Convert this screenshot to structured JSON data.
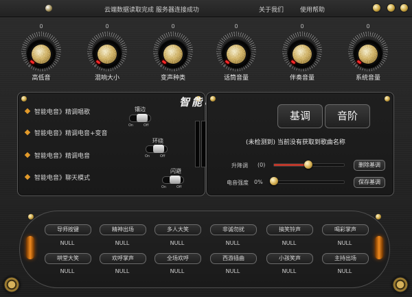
{
  "topbar": {
    "status": "云端数据读取完成 服务器连接成功",
    "about": "关于我们",
    "help": "使用帮助"
  },
  "knobs": [
    {
      "label": "高低音",
      "value": "0"
    },
    {
      "label": "混响大小",
      "value": "0"
    },
    {
      "label": "变声种类",
      "value": "0"
    },
    {
      "label": "话筒音量",
      "value": "0"
    },
    {
      "label": "伴奏音量",
      "value": "0"
    },
    {
      "label": "系统音量",
      "value": "0"
    }
  ],
  "modes": [
    {
      "label": "智能电音》精调唱歌"
    },
    {
      "label": "智能电音》精调电音+变音"
    },
    {
      "label": "智能电音》精调电音"
    },
    {
      "label": "智能电音》聊天模式"
    }
  ],
  "toggles": [
    {
      "label": "镶边",
      "on": "On",
      "off": "Off"
    },
    {
      "label": "环绕",
      "on": "On",
      "off": "Off"
    },
    {
      "label": "闪避",
      "on": "On",
      "off": "Off"
    }
  ],
  "center_title": "智能电音",
  "key_button": "基调",
  "scale_button": "音阶",
  "song_status": "(未检测到)  当前没有获取到歌曲名称",
  "pitch": {
    "label": "升降调",
    "value": "(0)"
  },
  "strength": {
    "label": "电音强度",
    "value": "0%"
  },
  "delete_key_button": "删除基调",
  "save_key_button": "保存基调",
  "pads": [
    {
      "label": "导师按键",
      "value": "NULL"
    },
    {
      "label": "精神出场",
      "value": "NULL"
    },
    {
      "label": "多人大笑",
      "value": "NULL"
    },
    {
      "label": "非诚勿扰",
      "value": "NULL"
    },
    {
      "label": "搞笑铃声",
      "value": "NULL"
    },
    {
      "label": "喝彩掌声",
      "value": "NULL"
    },
    {
      "label": "哄堂大笑",
      "value": "NULL"
    },
    {
      "label": "欢呼掌声",
      "value": "NULL"
    },
    {
      "label": "全场欢呼",
      "value": "NULL"
    },
    {
      "label": "西游插曲",
      "value": "NULL"
    },
    {
      "label": "小孩笑声",
      "value": "NULL"
    },
    {
      "label": "主持出场",
      "value": "NULL"
    }
  ]
}
